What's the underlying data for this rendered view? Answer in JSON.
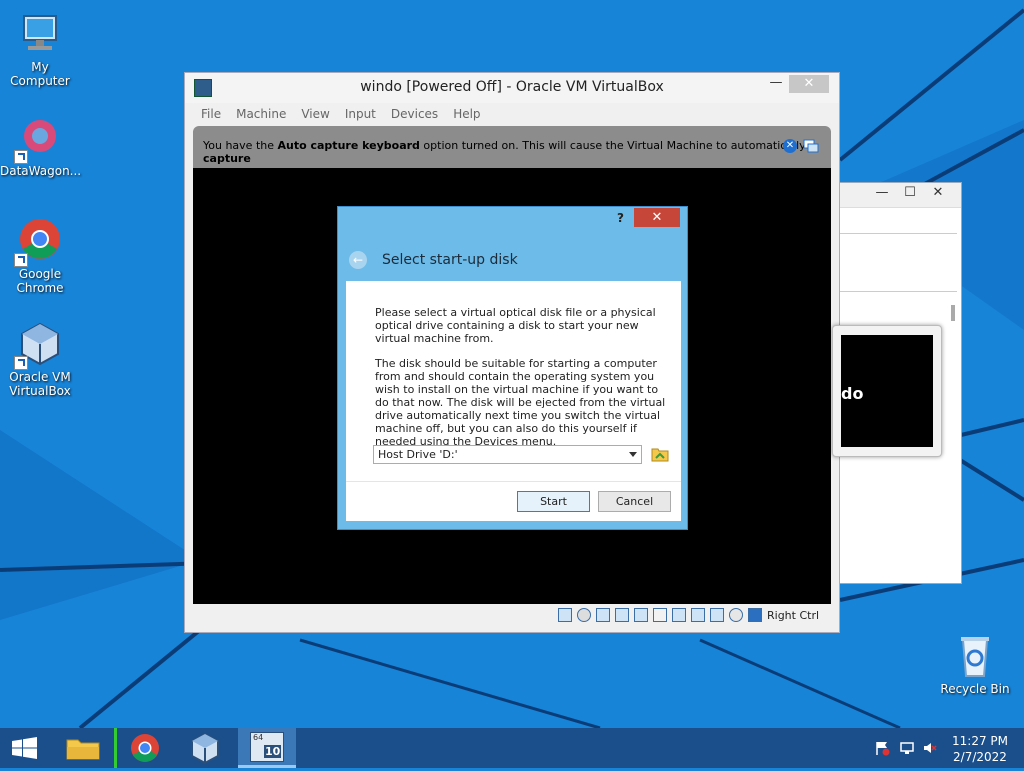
{
  "desktop": {
    "icons": [
      {
        "label": "My Computer"
      },
      {
        "label": "DataWagon..."
      },
      {
        "label": "Google Chrome"
      },
      {
        "label": "Oracle VM VirtualBox"
      },
      {
        "label": "Recycle Bin"
      }
    ]
  },
  "vm_window": {
    "title": "windo [Powered Off] - Oracle VM VirtualBox",
    "menu": [
      "File",
      "Machine",
      "View",
      "Input",
      "Devices",
      "Help"
    ],
    "banner": {
      "prefix": "You have the ",
      "bold1": "Auto capture keyboard",
      "middle": " option turned on. This will cause the Virtual Machine to automatically ",
      "bold2": "capture"
    },
    "host_key": "Right Ctrl"
  },
  "dialog": {
    "help": "?",
    "close": "✕",
    "heading": "Select start-up disk",
    "paragraph1": "Please select a virtual optical disk file or a physical optical drive containing a disk to start your new virtual machine from.",
    "paragraph2": "The disk should be suitable for starting a computer from and should contain the operating system you wish to install on the virtual machine if you want to do that now. The disk will be ejected from the virtual drive automatically next time you switch the virtual machine off, but you can also do this yourself if needed using the Devices menu.",
    "selected_disk": "Host Drive 'D:'",
    "start_label": "Start",
    "cancel_label": "Cancel"
  },
  "preview": {
    "label": "do"
  },
  "taskbar": {
    "vm_badge_top": "64",
    "vm_badge": "10",
    "clock_time": "11:27 PM",
    "clock_date": "2/7/2022"
  },
  "window_buttons": {
    "minimize": "—",
    "maximize": "☐",
    "close": "✕"
  },
  "colors": {
    "desktop": "#1784d8",
    "taskbar": "#1a4f8c",
    "dialog_frame": "#6cbbe8",
    "dialog_close": "#c7463a"
  }
}
